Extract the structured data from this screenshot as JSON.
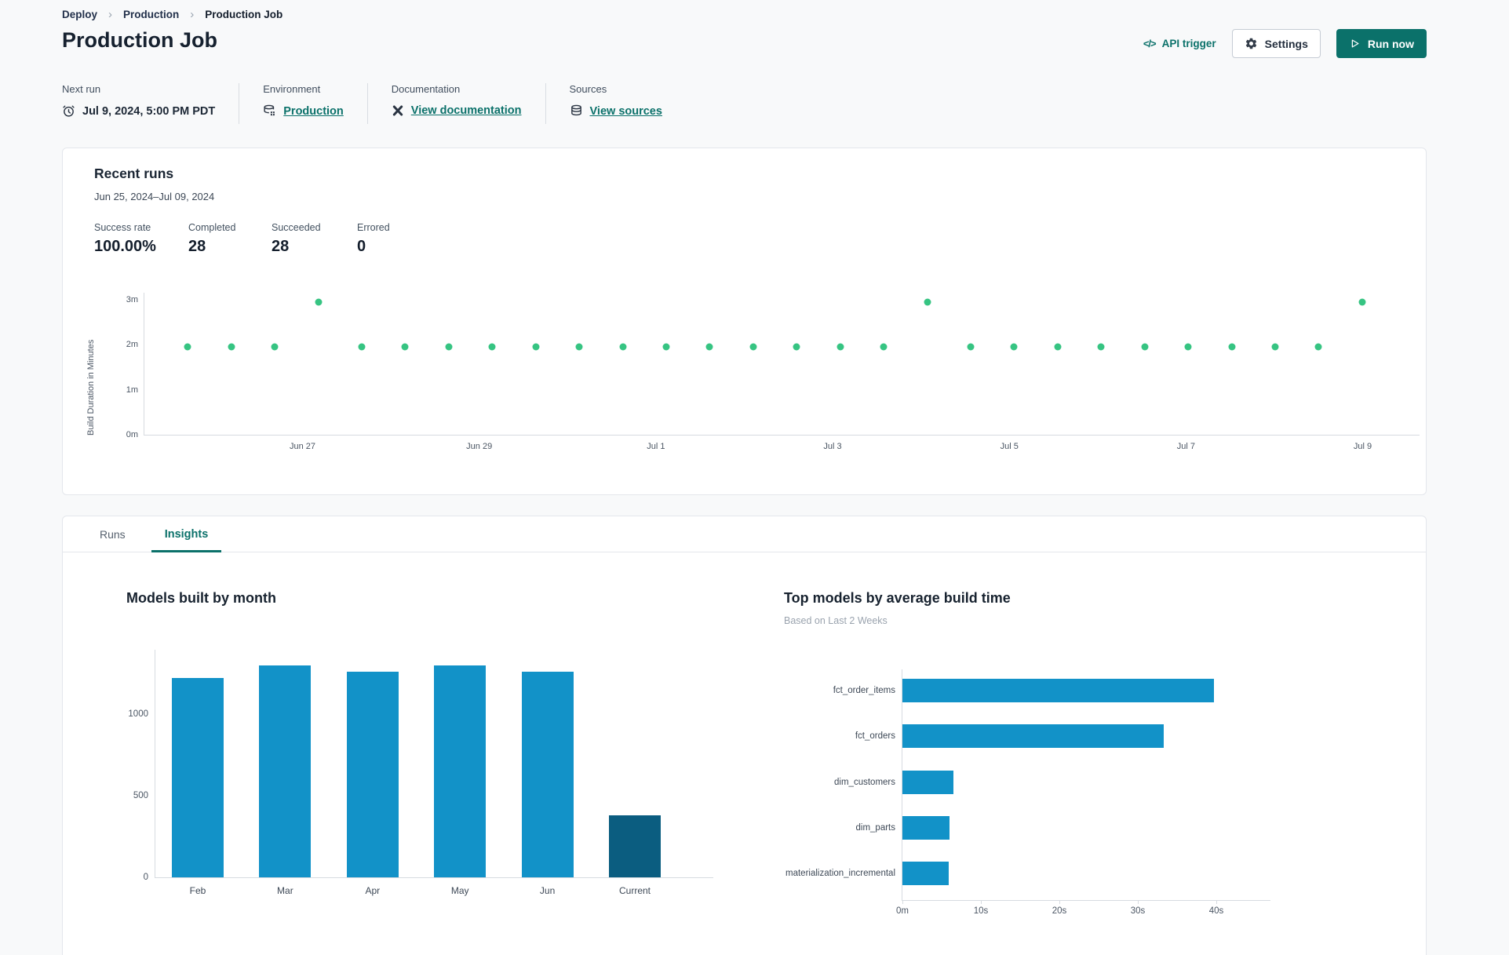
{
  "breadcrumb": {
    "items": [
      "Deploy",
      "Production",
      "Production Job"
    ],
    "separator": "›"
  },
  "header": {
    "title": "Production Job",
    "api_trigger_icon": "</>",
    "api_trigger_label": "API trigger",
    "settings_label": "Settings",
    "run_now_label": "Run now"
  },
  "meta": {
    "next_run": {
      "label": "Next run",
      "icon": "alarm-clock",
      "value": "Jul 9, 2024, 5:00 PM PDT"
    },
    "environment": {
      "label": "Environment",
      "icon": "database-gear",
      "value": "Production"
    },
    "documentation": {
      "label": "Documentation",
      "icon": "dbt-docs",
      "value": "View documentation"
    },
    "sources": {
      "label": "Sources",
      "icon": "database",
      "value": "View sources"
    }
  },
  "recent_runs": {
    "title": "Recent runs",
    "date_range": "Jun 25, 2024–Jul 09, 2024",
    "stats": [
      {
        "label": "Success rate",
        "value": "100.00%"
      },
      {
        "label": "Completed",
        "value": "28"
      },
      {
        "label": "Succeeded",
        "value": "28"
      },
      {
        "label": "Errored",
        "value": "0"
      }
    ]
  },
  "tabs": [
    {
      "label": "Runs",
      "active": false
    },
    {
      "label": "Insights",
      "active": true
    }
  ],
  "colors": {
    "accent_teal": "#0b716a",
    "dot_green": "#36c482",
    "bar_blue": "#1292c8",
    "bar_dark_blue": "#0b5d80"
  },
  "chart_data": [
    {
      "type": "scatter",
      "title": "Recent runs build durations",
      "ylabel": "Build Duration in Minutes",
      "y_ticks": [
        "0m",
        "1m",
        "2m",
        "3m"
      ],
      "y_tick_values": [
        0,
        1,
        2,
        3
      ],
      "ylim": [
        0,
        3.16
      ],
      "x_tick_labels": [
        "Jun 27",
        "Jun 29",
        "Jul 1",
        "Jul 3",
        "Jul 5",
        "Jul 7",
        "Jul 9"
      ],
      "points_minutes": [
        1.95,
        1.95,
        1.95,
        2.95,
        1.95,
        1.95,
        1.95,
        1.95,
        1.95,
        1.95,
        1.95,
        1.95,
        1.95,
        1.95,
        1.95,
        1.95,
        1.95,
        2.95,
        1.95,
        1.95,
        1.95,
        1.95,
        1.95,
        1.95,
        1.95,
        1.95,
        1.95,
        2.95
      ],
      "point_color": "#36c482",
      "grid": false
    },
    {
      "type": "bar",
      "title": "Models built by month",
      "categories": [
        "Feb",
        "Mar",
        "Apr",
        "May",
        "Jun",
        "Current"
      ],
      "values": [
        1220,
        1300,
        1260,
        1300,
        1260,
        380
      ],
      "y_ticks": [
        "0",
        "500",
        "1000"
      ],
      "y_tick_values": [
        0,
        500,
        1000
      ],
      "ylim": [
        0,
        1400
      ],
      "bar_color": "#1292c8",
      "highlight_index": 5,
      "highlight_color": "#0b5d80",
      "grid": false
    },
    {
      "type": "bar-horizontal",
      "title": "Top models by average build time",
      "subtitle": "Based on Last 2 Weeks",
      "categories": [
        "fct_order_items",
        "fct_orders",
        "dim_customers",
        "dim_parts",
        "materialization_incremental"
      ],
      "values_seconds": [
        39.7,
        33.3,
        6.5,
        6.0,
        5.9
      ],
      "x_ticks": [
        "0m",
        "10s",
        "20s",
        "30s",
        "40s"
      ],
      "x_tick_seconds": [
        0,
        10,
        20,
        30,
        40
      ],
      "xlim": [
        0,
        47
      ],
      "bar_color": "#1292c8",
      "grid": false
    }
  ]
}
